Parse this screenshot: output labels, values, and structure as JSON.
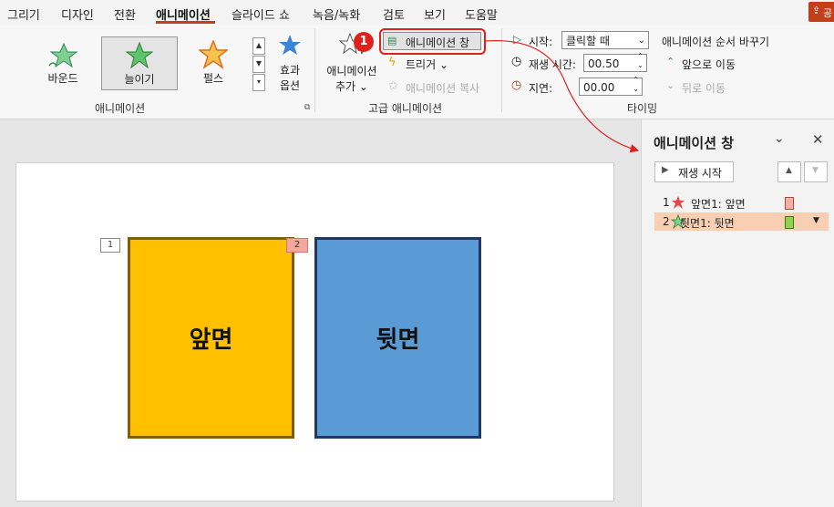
{
  "menu": {
    "items": [
      "그리기",
      "디자인",
      "전환",
      "애니메이션",
      "슬라이드 쇼",
      "녹음/녹화",
      "검토",
      "보기",
      "도움말"
    ],
    "active": "애니메이션",
    "share_label": "공"
  },
  "ribbon": {
    "gallery": {
      "items": [
        "바운드",
        "늘이기",
        "펄스"
      ],
      "selected": "늘이기"
    },
    "effect_options": {
      "line1": "효과",
      "line2": "옵션"
    },
    "group_animation": "애니메이션",
    "add_animation": {
      "line1": "애니메이션",
      "line2": "추가"
    },
    "animation_pane_button": "애니메이션 창",
    "trigger": "트리거",
    "animation_painter": "애니메이션 복사",
    "group_advanced": "고급 애니메이션",
    "start_label": "시작:",
    "start_value": "클릭할 때",
    "duration_label": "재생 시간:",
    "duration_value": "00.50",
    "delay_label": "지연:",
    "delay_value": "00.00",
    "reorder_title": "애니메이션 순서 바꾸기",
    "move_earlier": "앞으로 이동",
    "move_later": "뒤로 이동",
    "group_timing": "타이밍"
  },
  "callout": {
    "number": "1"
  },
  "slide": {
    "front": {
      "text": "앞면",
      "tag": "1",
      "color": "#ffc000",
      "border": "#7f6000"
    },
    "back": {
      "text": "뒷면",
      "tag": "2",
      "color": "#5b9bd5",
      "border": "#1f3864"
    }
  },
  "pane": {
    "title": "애니메이션 창",
    "play_button": "재생 시작",
    "items": [
      {
        "num": "1",
        "label": "앞면1: 앞면",
        "icon": "red-star-icon",
        "bar_color": "#f4b0a6"
      },
      {
        "num": "2",
        "label": "뒷면1: 뒷면",
        "icon": "green-star-icon",
        "bar_color": "#92d050"
      }
    ]
  },
  "colors": {
    "accent": "#c43e1c",
    "callout": "#e0201b",
    "selection": "#f8cfb2"
  }
}
